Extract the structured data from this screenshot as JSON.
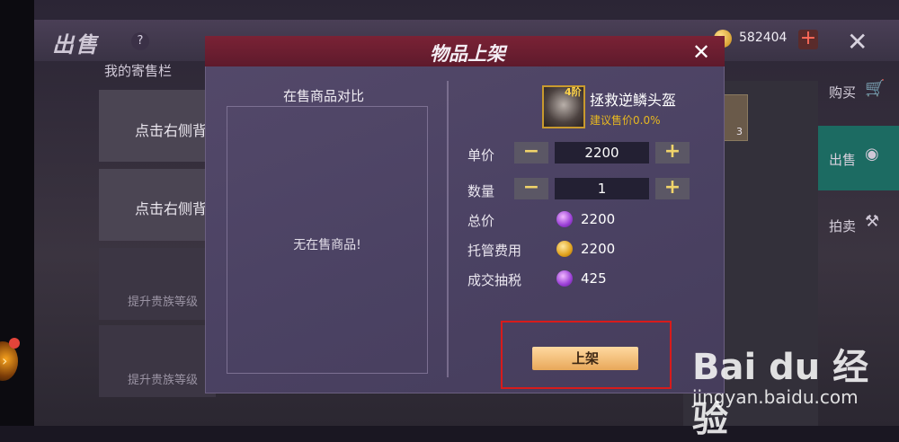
{
  "header": {
    "title": "出售",
    "help_label": "?",
    "gold_amount": "582404",
    "add_label": "+",
    "close_label": "✕"
  },
  "stall": {
    "title": "我的寄售栏",
    "slots": [
      {
        "text": "点击右侧背",
        "locked": false
      },
      {
        "text": "点击右侧背",
        "locked": false
      },
      {
        "text": "提升贵族等级",
        "locked": true
      },
      {
        "text": "提升贵族等级",
        "locked": true
      }
    ]
  },
  "bag": {
    "item_count": "3"
  },
  "side_nav": [
    {
      "label": "购买",
      "icon": "cart-icon",
      "active": false
    },
    {
      "label": "出售",
      "icon": "sell-icon",
      "active": true
    },
    {
      "label": "拍卖",
      "icon": "hammer-icon",
      "active": false
    }
  ],
  "modal": {
    "title": "物品上架",
    "close_label": "✕",
    "compare_title": "在售商品对比",
    "empty_text": "无在售商品!",
    "item": {
      "tier": "4阶",
      "name": "拯救逆鳞头盔",
      "price_hint": "建议售价0.0%"
    },
    "unit_price": {
      "label": "单价",
      "value": "2200",
      "minus": "−",
      "plus": "+"
    },
    "quantity": {
      "label": "数量",
      "value": "1",
      "minus": "−",
      "plus": "+"
    },
    "total": {
      "label": "总价",
      "value": "2200",
      "currency": "purple-crystal-icon"
    },
    "custody_fee": {
      "label": "托管费用",
      "value": "2200",
      "currency": "gold-coin-icon"
    },
    "tax": {
      "label": "成交抽税",
      "value": "425",
      "currency": "purple-crystal-icon"
    },
    "submit_label": "上架"
  },
  "watermark": {
    "brand": "Bai du 经验",
    "url": "jingyan.baidu.com"
  },
  "colors": {
    "accent": "#1c6b62",
    "header": "#7a2235",
    "button": "#e8a85a",
    "highlight": "#d81b1b"
  }
}
